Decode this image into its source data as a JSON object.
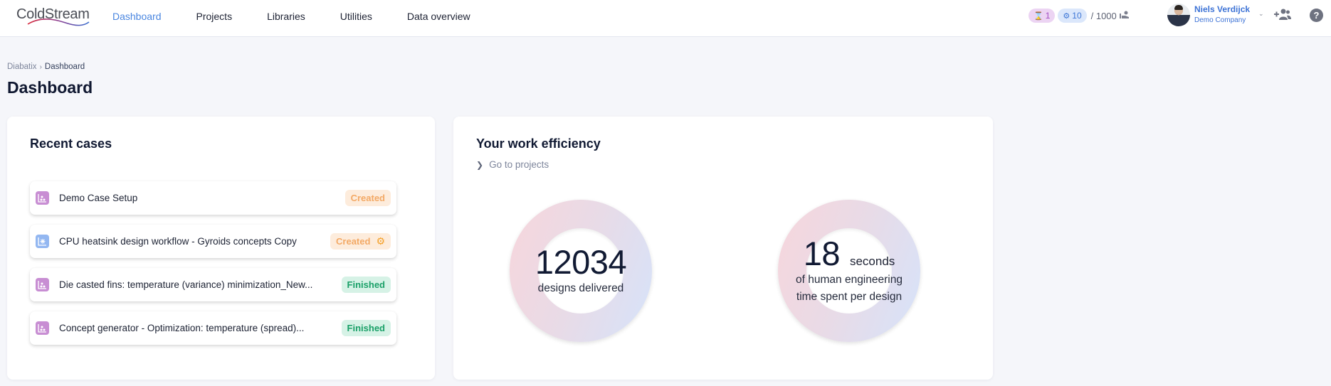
{
  "header": {
    "logo_text": "ColdStream",
    "nav": [
      {
        "label": "Dashboard",
        "active": true
      },
      {
        "label": "Projects",
        "active": false
      },
      {
        "label": "Libraries",
        "active": false
      },
      {
        "label": "Utilities",
        "active": false
      },
      {
        "label": "Data overview",
        "active": false
      }
    ],
    "queue_badge": {
      "icon": "hourglass-icon",
      "count": "1"
    },
    "jobs_badge": {
      "icon": "gears-icon",
      "count": "10"
    },
    "quota": "/ 1000",
    "user": {
      "name": "Niels Verdijck",
      "company": "Demo Company"
    },
    "help_label": "?"
  },
  "breadcrumb": {
    "root": "Diabatix",
    "separator": "›",
    "current": "Dashboard"
  },
  "page_title": "Dashboard",
  "recent_cases": {
    "title": "Recent cases",
    "items": [
      {
        "name": "Demo Case Setup",
        "status": "Created",
        "icon": "scatter-chart-icon",
        "icon_color": "#c88ed3",
        "has_gear": false
      },
      {
        "name": "CPU heatsink design workflow - Gyroids concepts Copy",
        "status": "Created",
        "icon": "snowflake-chart-icon",
        "icon_color": "#93b7f1",
        "has_gear": true
      },
      {
        "name": "Die casted fins: temperature (variance) minimization_New...",
        "status": "Finished",
        "icon": "scatter-chart-icon",
        "icon_color": "#c88ed3",
        "has_gear": false
      },
      {
        "name": "Concept generator - Optimization: temperature (spread)...",
        "status": "Finished",
        "icon": "scatter-chart-icon",
        "icon_color": "#c88ed3",
        "has_gear": false
      }
    ]
  },
  "efficiency": {
    "title": "Your work efficiency",
    "go_to_projects": "Go to projects",
    "designs": {
      "value": "12034",
      "label": "designs delivered"
    },
    "time": {
      "value": "18",
      "unit": "seconds",
      "label_line1": "of human engineering",
      "label_line2": "time spent per design"
    }
  },
  "colors": {
    "accent": "#4a86e0",
    "created_bg": "#fdecdc",
    "created_text": "#f3a965",
    "finished_bg": "#d6f2e6",
    "finished_text": "#1aa068"
  }
}
